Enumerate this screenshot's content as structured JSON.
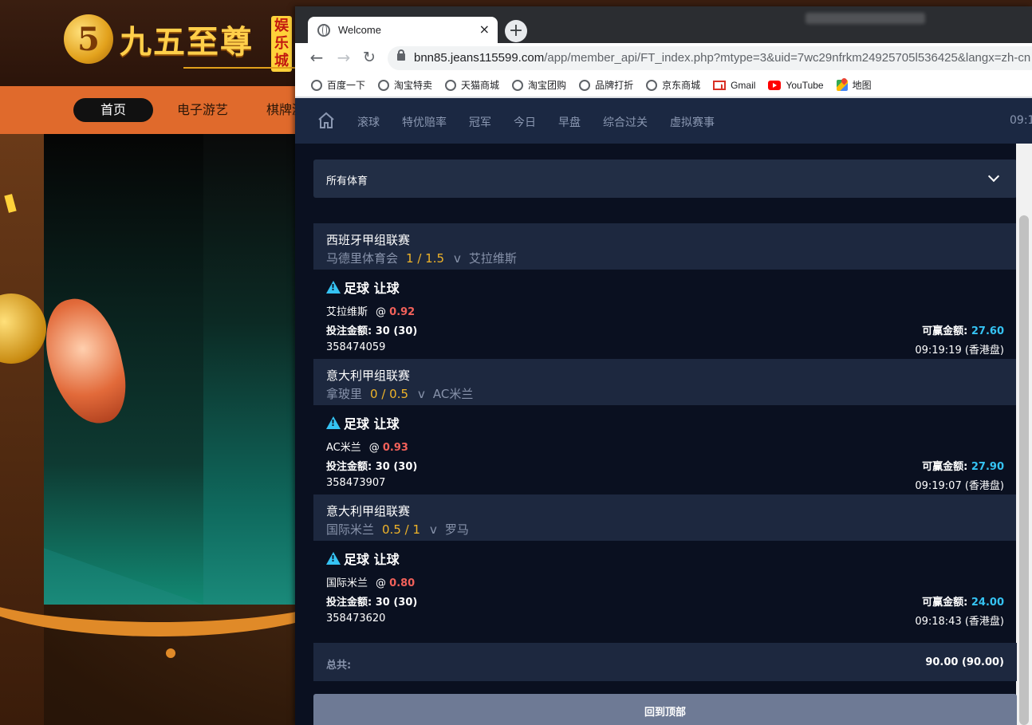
{
  "background_site": {
    "logo_mark": "5",
    "logo_text": "九五至尊",
    "logo_badge": "娱乐城",
    "nav": [
      "首页",
      "电子游艺",
      "棋牌游"
    ]
  },
  "browser": {
    "tab_title": "Welcome",
    "tab_close": "×",
    "new_tab": "+",
    "url_host": "bnn85.jeans115599.com",
    "url_path": "/app/member_api/FT_index.php?mtype=3&uid=7wc29nfrkm24925705l536425&langx=zh-cn",
    "bookmarks": [
      {
        "icon": "globe-icon",
        "label": "百度一下"
      },
      {
        "icon": "globe-icon",
        "label": "淘宝特卖"
      },
      {
        "icon": "globe-icon",
        "label": "天猫商城"
      },
      {
        "icon": "globe-icon",
        "label": "淘宝团购"
      },
      {
        "icon": "globe-icon",
        "label": "品牌打折"
      },
      {
        "icon": "globe-icon",
        "label": "京东商城"
      },
      {
        "icon": "gmail-icon",
        "label": "Gmail"
      },
      {
        "icon": "youtube-icon",
        "label": "YouTube"
      },
      {
        "icon": "maps-icon",
        "label": "地图"
      }
    ]
  },
  "sport_nav": {
    "items": [
      "滚球",
      "特优赔率",
      "冠军",
      "今日",
      "早盘",
      "综合过关",
      "虚拟赛事"
    ],
    "clock": "09:1"
  },
  "sport_select": {
    "label": "所有体育"
  },
  "bets": [
    {
      "league": "西班牙甲组联赛",
      "home": "马德里体育会",
      "handicap": "1 / 1.5",
      "vs": "v",
      "away": "艾拉维斯",
      "bet_type": "足球 让球",
      "selection": "艾拉维斯",
      "at": "@",
      "odds": "0.92",
      "stake_label": "投注金额:",
      "stake": "30 (30)",
      "win_label": "可赢金额:",
      "win": "27.60",
      "ticket": "358474059",
      "time": "09:19:19 (香港盘)"
    },
    {
      "league": "意大利甲组联赛",
      "home": "拿玻里",
      "handicap": "0 / 0.5",
      "vs": "v",
      "away": "AC米兰",
      "bet_type": "足球 让球",
      "selection": "AC米兰",
      "at": "@",
      "odds": "0.93",
      "stake_label": "投注金额:",
      "stake": "30 (30)",
      "win_label": "可赢金额:",
      "win": "27.90",
      "ticket": "358473907",
      "time": "09:19:07 (香港盘)"
    },
    {
      "league": "意大利甲组联赛",
      "home": "国际米兰",
      "handicap": "0.5 / 1",
      "vs": "v",
      "away": "罗马",
      "bet_type": "足球 让球",
      "selection": "国际米兰",
      "at": "@",
      "odds": "0.80",
      "stake_label": "投注金额:",
      "stake": "30 (30)",
      "win_label": "可赢金额:",
      "win": "24.00",
      "ticket": "358473620",
      "time": "09:18:43 (香港盘)"
    }
  ],
  "total": {
    "label": "总共:",
    "value": "90.00 (90.00)"
  },
  "back_to_top": "回到顶部",
  "colors": {
    "page_bg": "#0a1020",
    "row_bg": "#1d283f",
    "handicap": "#f0b429",
    "odds": "#f2615a",
    "win": "#35c3f3",
    "button": "#6e7a95"
  }
}
